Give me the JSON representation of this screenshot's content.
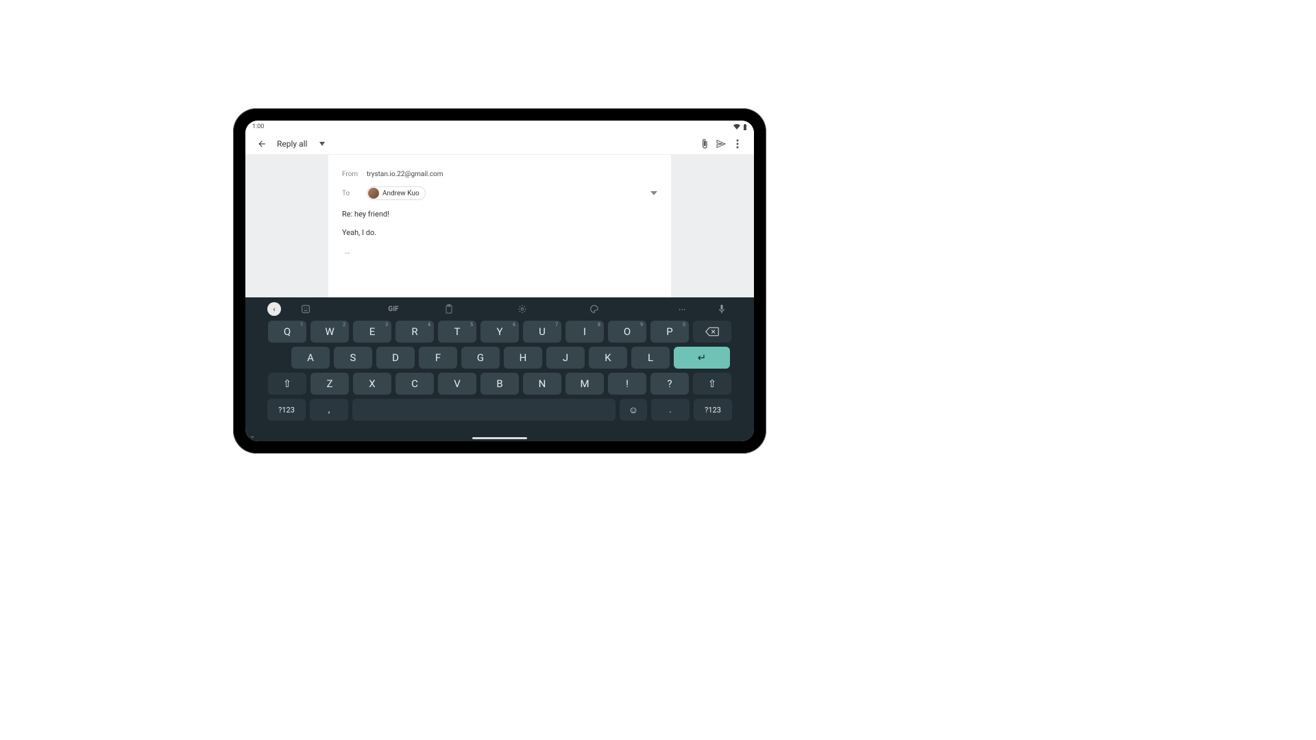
{
  "status": {
    "time": "1:00",
    "wifi_icon": "▾",
    "battery_icon": "▮"
  },
  "appbar": {
    "title": "Reply all"
  },
  "compose": {
    "from_label": "From",
    "from_value": "trystan.io.22@gmail.com",
    "to_label": "To",
    "to_chip_name": "Andrew Kuo",
    "subject": "Re: hey friend!",
    "body": "Yeah, I do.",
    "ellipsis": "…"
  },
  "keyboard": {
    "toolbar": {
      "back": "‹",
      "sticker": "☺",
      "gif": "GIF",
      "clipboard": "▤",
      "settings": "⚙",
      "palette": "🎨",
      "more": "⋯",
      "mic": "🎤"
    },
    "rows": {
      "r1": [
        {
          "label": "Q",
          "sup": "1"
        },
        {
          "label": "W",
          "sup": "2"
        },
        {
          "label": "E",
          "sup": "3"
        },
        {
          "label": "R",
          "sup": "4"
        },
        {
          "label": "T",
          "sup": "5"
        },
        {
          "label": "Y",
          "sup": "6"
        },
        {
          "label": "U",
          "sup": "7"
        },
        {
          "label": "I",
          "sup": "8"
        },
        {
          "label": "O",
          "sup": "9"
        },
        {
          "label": "P",
          "sup": "0"
        }
      ],
      "r2": [
        {
          "label": "A"
        },
        {
          "label": "S"
        },
        {
          "label": "D"
        },
        {
          "label": "F"
        },
        {
          "label": "G"
        },
        {
          "label": "H"
        },
        {
          "label": "J"
        },
        {
          "label": "K"
        },
        {
          "label": "L"
        }
      ],
      "r3": [
        {
          "label": "Z"
        },
        {
          "label": "X"
        },
        {
          "label": "C"
        },
        {
          "label": "V"
        },
        {
          "label": "B"
        },
        {
          "label": "N"
        },
        {
          "label": "M"
        },
        {
          "label": "!"
        },
        {
          "label": "?"
        }
      ],
      "shift": "⇧",
      "backspace": "⌫",
      "enter": "↵",
      "mode": "?123",
      "comma": ",",
      "dot": ".",
      "emoji": "☺"
    },
    "collapse": "⌄"
  }
}
